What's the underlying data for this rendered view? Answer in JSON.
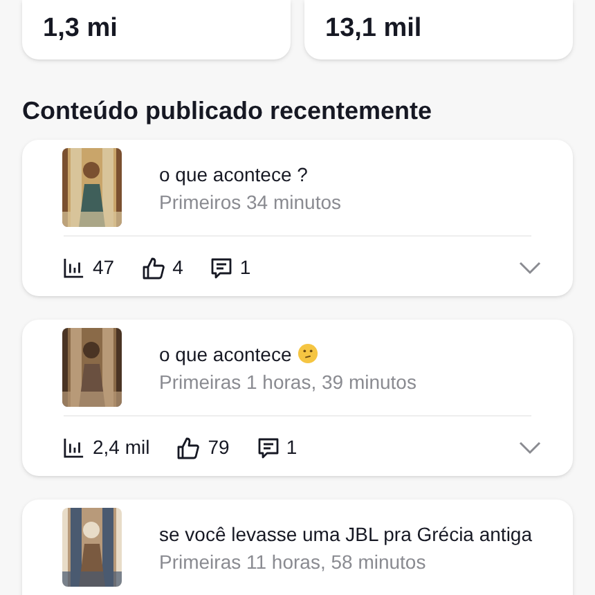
{
  "summary_cards": [
    {
      "value": "1,3 mi"
    },
    {
      "value": "13,1 mil"
    }
  ],
  "section_title": "Conteúdo publicado recentemente",
  "posts": [
    {
      "title": "o que acontece ?",
      "emoji": false,
      "age": "Primeiros 34 minutos",
      "views": "47",
      "likes": "4",
      "comments": "1"
    },
    {
      "title": "o que acontece",
      "emoji": true,
      "age": "Primeiras 1 horas, 39 minutos",
      "views": "2,4 mil",
      "likes": "79",
      "comments": "1"
    },
    {
      "title": "se você levasse uma JBL pra Grécia antiga",
      "emoji": false,
      "age": "Primeiras 11 horas, 58 minutos"
    }
  ]
}
